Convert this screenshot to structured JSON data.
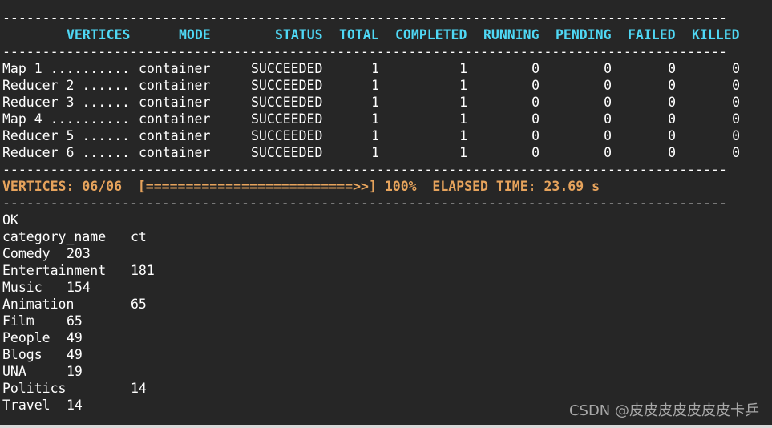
{
  "separator": "-------------------------------------------------------------------------------------------",
  "headers": {
    "vertices": "VERTICES",
    "mode": "MODE",
    "status": "STATUS",
    "total": "TOTAL",
    "completed": "COMPLETED",
    "running": "RUNNING",
    "pending": "PENDING",
    "failed": "FAILED",
    "killed": "KILLED"
  },
  "rows": [
    {
      "vertex": "Map 1 ..........",
      "mode": "container",
      "status": "SUCCEEDED",
      "total": "1",
      "completed": "1",
      "running": "0",
      "pending": "0",
      "failed": "0",
      "killed": "0"
    },
    {
      "vertex": "Reducer 2 ......",
      "mode": "container",
      "status": "SUCCEEDED",
      "total": "1",
      "completed": "1",
      "running": "0",
      "pending": "0",
      "failed": "0",
      "killed": "0"
    },
    {
      "vertex": "Reducer 3 ......",
      "mode": "container",
      "status": "SUCCEEDED",
      "total": "1",
      "completed": "1",
      "running": "0",
      "pending": "0",
      "failed": "0",
      "killed": "0"
    },
    {
      "vertex": "Map 4 ..........",
      "mode": "container",
      "status": "SUCCEEDED",
      "total": "1",
      "completed": "1",
      "running": "0",
      "pending": "0",
      "failed": "0",
      "killed": "0"
    },
    {
      "vertex": "Reducer 5 ......",
      "mode": "container",
      "status": "SUCCEEDED",
      "total": "1",
      "completed": "1",
      "running": "0",
      "pending": "0",
      "failed": "0",
      "killed": "0"
    },
    {
      "vertex": "Reducer 6 ......",
      "mode": "container",
      "status": "SUCCEEDED",
      "total": "1",
      "completed": "1",
      "running": "0",
      "pending": "0",
      "failed": "0",
      "killed": "0"
    }
  ],
  "progress_line": "VERTICES: 06/06  [==========================>>] 100%  ELAPSED TIME: 23.69 s",
  "ok": "OK",
  "result_header": {
    "name": "category_name",
    "ct": "ct"
  },
  "results": [
    {
      "name": "Comedy",
      "ct": "203",
      "layout": "short"
    },
    {
      "name": "Entertainment",
      "ct": "181",
      "layout": "long"
    },
    {
      "name": "Music",
      "ct": "154",
      "layout": "short"
    },
    {
      "name": "Animation",
      "ct": "65",
      "layout": "long"
    },
    {
      "name": "Film",
      "ct": "65",
      "layout": "short"
    },
    {
      "name": "People",
      "ct": "49",
      "layout": "short"
    },
    {
      "name": "Blogs",
      "ct": "49",
      "layout": "short"
    },
    {
      "name": "UNA",
      "ct": "19",
      "layout": "short"
    },
    {
      "name": "Politics",
      "ct": "14",
      "layout": "long"
    },
    {
      "name": "Travel",
      "ct": "14",
      "layout": "short"
    }
  ],
  "watermark": "CSDN @皮皮皮皮皮皮皮卡乒"
}
